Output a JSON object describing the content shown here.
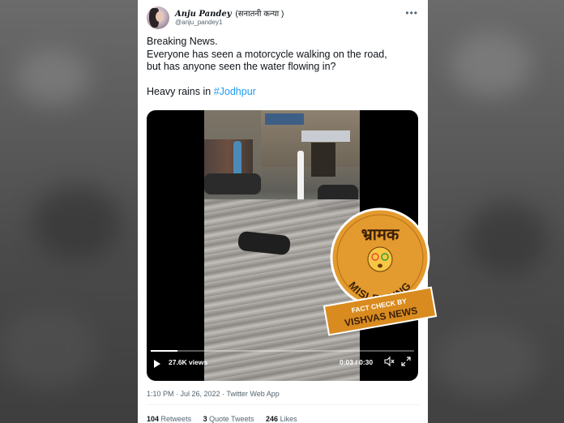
{
  "tweet": {
    "display_name": "Anju Pandey",
    "display_name_suffix": "(सनातनी कन्या )",
    "handle": "@anju_pandey1",
    "more_icon": "more-icon",
    "text_lines": [
      "Breaking News.",
      "Everyone has seen a motorcycle walking on the road,",
      "but has anyone seen the water flowing in?"
    ],
    "text_tail_prefix": "Heavy rains in ",
    "hashtag": "#Jodhpur",
    "hashtag_color": "#1d9bf0",
    "timestamp": "1:10 PM · Jul 26, 2022 · Twitter Web App",
    "stats": [
      {
        "count": "104",
        "label": "Retweets"
      },
      {
        "count": "3",
        "label": "Quote Tweets"
      },
      {
        "count": "246",
        "label": "Likes"
      }
    ]
  },
  "video": {
    "views": "27.6K views",
    "time": "0:03 / 0:30",
    "progress": 0.1,
    "play_icon": "play-icon",
    "volume_icon": "volume-icon",
    "fullscreen_icon": "fullscreen-icon"
  },
  "stamp": {
    "top_text": "भ्रामक",
    "verdict": "MISLEADING",
    "ribbon_line1": "FACT CHECK BY",
    "ribbon_line2": "VISHVAS NEWS",
    "badge_color": "#e39a2e",
    "ribbon_color": "#d98b1f"
  }
}
